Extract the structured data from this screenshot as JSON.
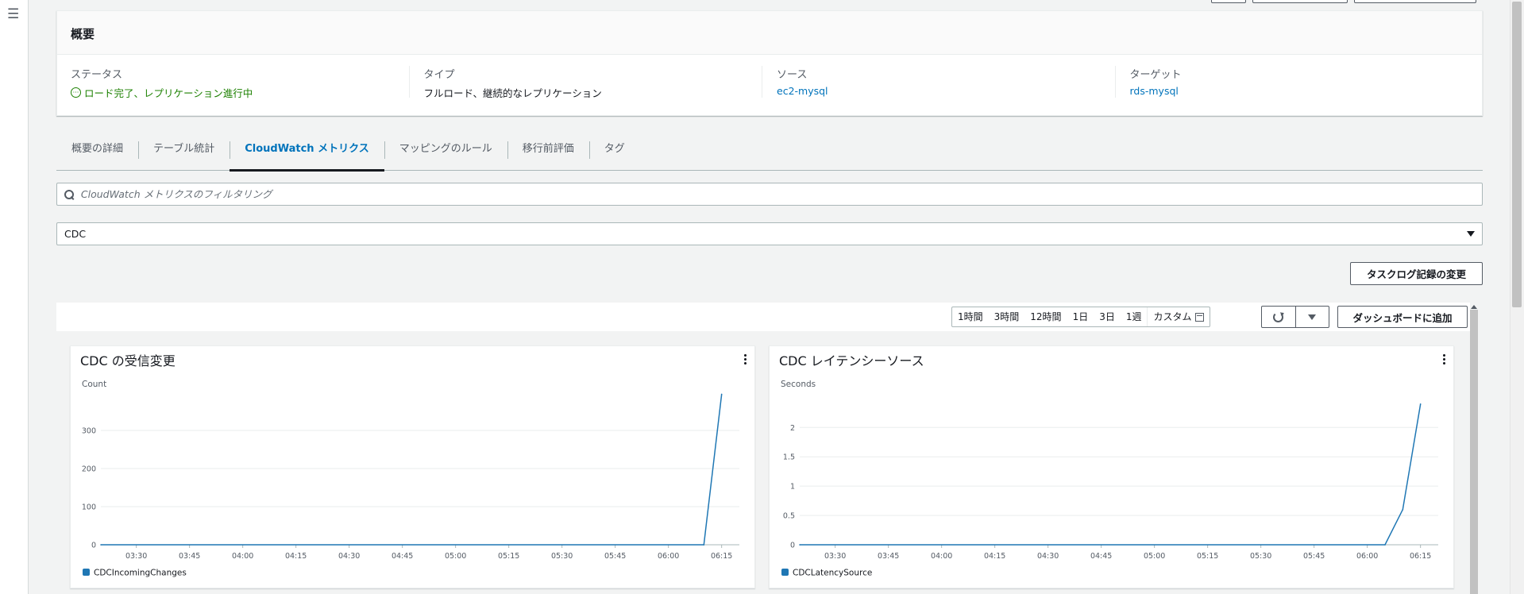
{
  "summary": {
    "title": "概要",
    "status_label": "ステータス",
    "status_value": "ロード完了、レプリケーション進行中",
    "type_label": "タイプ",
    "type_value": "フルロード、継続的なレプリケーション",
    "source_label": "ソース",
    "source_value": "ec2-mysql",
    "target_label": "ターゲット",
    "target_value": "rds-mysql"
  },
  "tabs": [
    "概要の詳細",
    "テーブル統計",
    "CloudWatch メトリクス",
    "マッピングのルール",
    "移行前評価",
    "タグ"
  ],
  "filter": {
    "placeholder": "CloudWatch メトリクスのフィルタリング"
  },
  "select": {
    "value": "CDC"
  },
  "tasklog_button": "タスクログ記録の変更",
  "time_ranges": [
    "1時間",
    "3時間",
    "12時間",
    "1日",
    "3日",
    "1週"
  ],
  "custom_label": "カスタム",
  "add_dashboard_button": "ダッシュボードに追加",
  "colors": {
    "series": "#1f77b4",
    "link": "#0073bb",
    "status": "#1d8102"
  },
  "chart_data": [
    {
      "type": "line",
      "title": "CDC の受信変更",
      "ylabel": "Count",
      "x": [
        "03:30",
        "03:45",
        "04:00",
        "04:15",
        "04:30",
        "04:45",
        "05:00",
        "05:15",
        "05:30",
        "05:45",
        "06:00",
        "06:15"
      ],
      "yticks": [
        0,
        100,
        200,
        300
      ],
      "ylim": [
        0,
        400
      ],
      "series": [
        {
          "name": "CDCIncomingChanges",
          "points": [
            [
              "03:20",
              0
            ],
            [
              "06:10",
              0
            ],
            [
              "06:15",
              395
            ]
          ]
        }
      ]
    },
    {
      "type": "line",
      "title": "CDC レイテンシーソース",
      "ylabel": "Seconds",
      "x": [
        "03:30",
        "03:45",
        "04:00",
        "04:15",
        "04:30",
        "04:45",
        "05:00",
        "05:15",
        "05:30",
        "05:45",
        "06:00",
        "06:15"
      ],
      "yticks": [
        0,
        0.5,
        1,
        1.5,
        2
      ],
      "ylim": [
        0,
        2.6
      ],
      "series": [
        {
          "name": "CDCLatencySource",
          "points": [
            [
              "03:20",
              0
            ],
            [
              "06:05",
              0
            ],
            [
              "06:10",
              0.6
            ],
            [
              "06:15",
              2.4
            ]
          ]
        }
      ]
    }
  ]
}
